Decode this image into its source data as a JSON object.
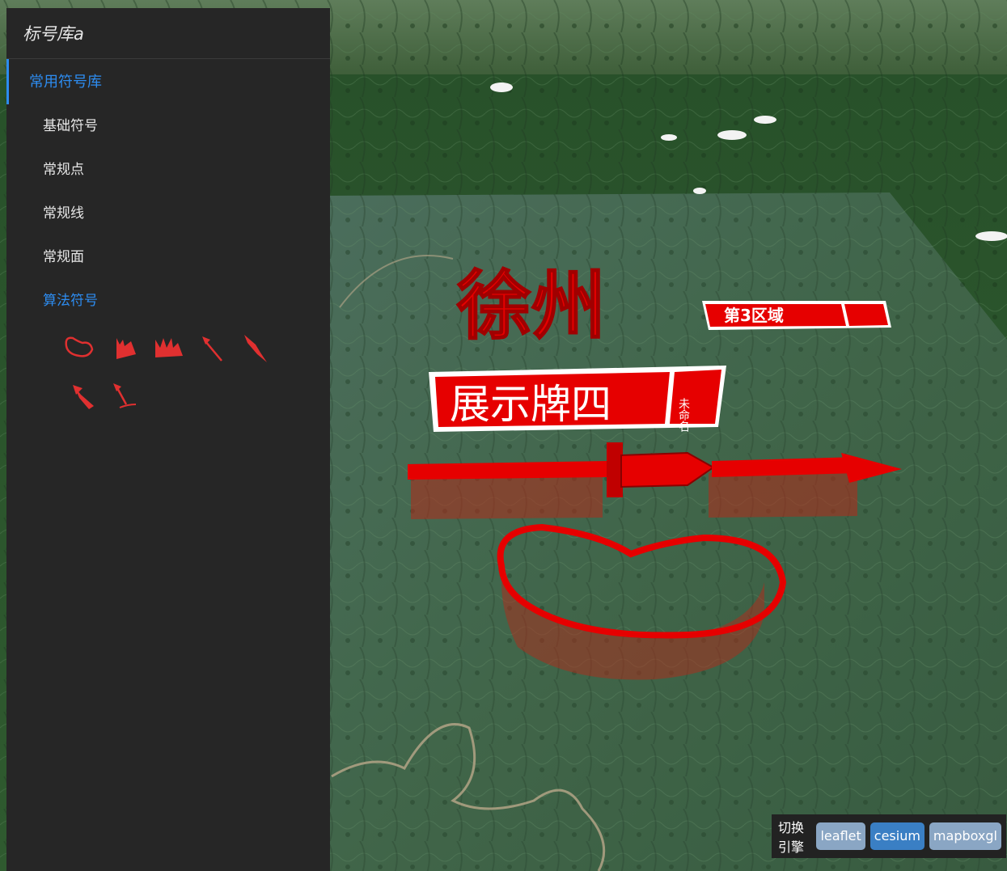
{
  "panel": {
    "title": "标号库a",
    "group_label": "常用符号库",
    "items": [
      {
        "label": "基础符号"
      },
      {
        "label": "常规点"
      },
      {
        "label": "常规线"
      },
      {
        "label": "常规面"
      },
      {
        "label": "算法符号"
      }
    ],
    "active_item": "算法符号",
    "symbols": [
      {
        "icon": "closed-curve-icon"
      },
      {
        "icon": "double-arrow-icon"
      },
      {
        "icon": "triple-arrow-icon"
      },
      {
        "icon": "straight-arrow-icon"
      },
      {
        "icon": "attack-arrow-icon"
      },
      {
        "icon": "tailed-arrow-icon"
      },
      {
        "icon": "fine-arrow-icon"
      }
    ]
  },
  "map": {
    "labels": [
      {
        "text": "徐州"
      },
      {
        "text": "第3区域"
      },
      {
        "text": "展示牌四"
      },
      {
        "text": "未命名"
      }
    ],
    "accent_color": "#e60000"
  },
  "engine_switch": {
    "label": "切换引擎",
    "buttons": [
      "leaflet",
      "cesium",
      "mapboxgl"
    ],
    "active": "cesium"
  }
}
